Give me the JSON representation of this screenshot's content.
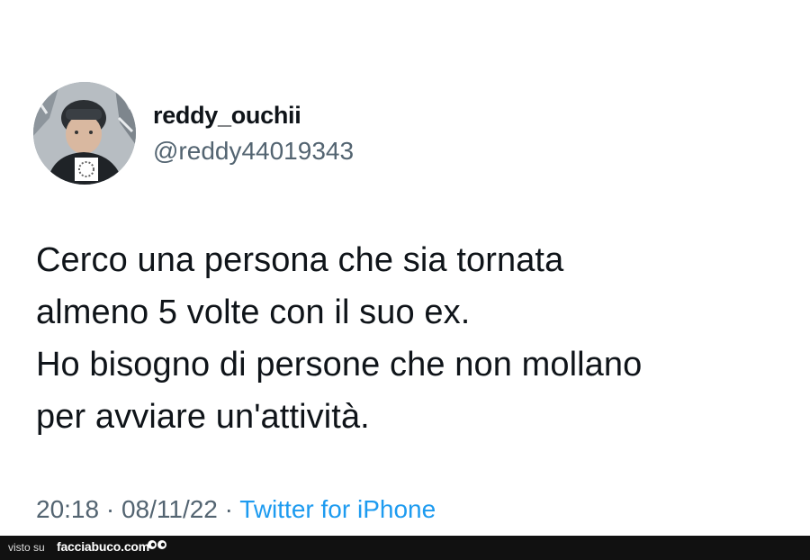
{
  "user": {
    "display_name": "reddy_ouchii",
    "handle": "@reddy44019343"
  },
  "tweet": {
    "lines": [
      "Cerco una persona che sia tornata",
      "almeno 5 volte con il suo ex.",
      "Ho bisogno di persone che non mollano",
      "per avviare un'attività."
    ]
  },
  "meta": {
    "time": "20:18",
    "separator1": " · ",
    "date": "08/11/22",
    "separator2": " · ",
    "source": "Twitter for iPhone"
  },
  "footer": {
    "visto_su": "visto su",
    "site": "facciabuco.com",
    "logo_icon": "eyes-icon"
  },
  "colors": {
    "text": "#0f1419",
    "secondary": "#536471",
    "link": "#1d9bf0",
    "footer_bg": "#111111"
  }
}
